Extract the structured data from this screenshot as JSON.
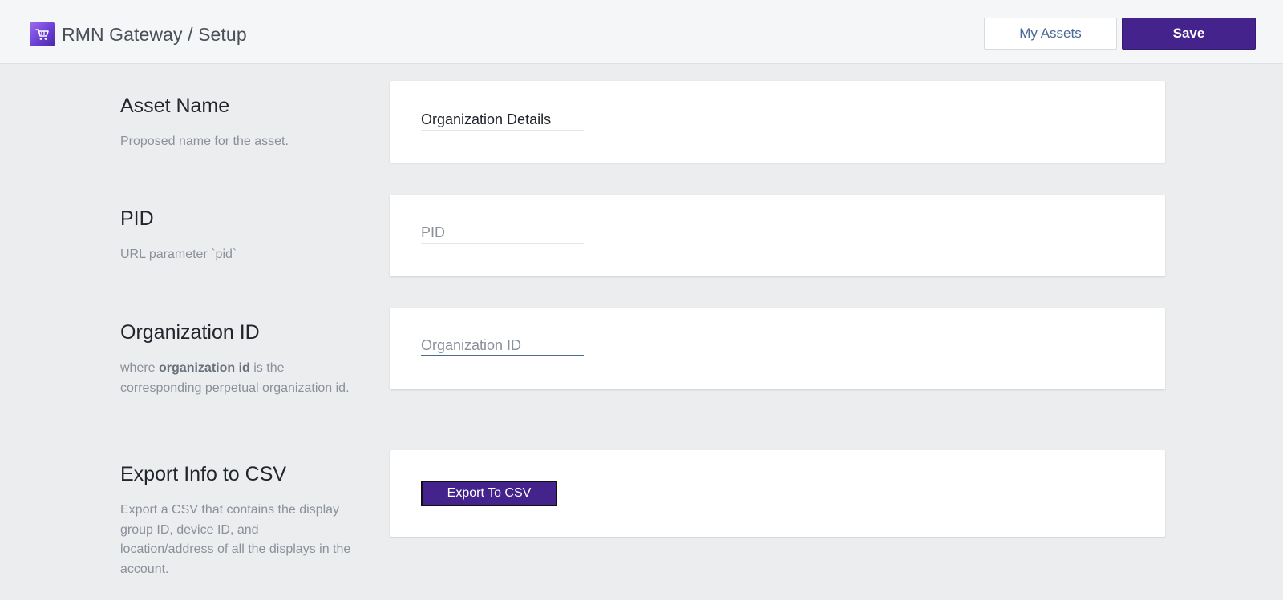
{
  "header": {
    "logo_icon": "shopping-cart-icon",
    "title": "RMN Gateway / Setup",
    "my_assets_label": "My Assets",
    "save_label": "Save"
  },
  "sections": {
    "asset_name": {
      "title": "Asset Name",
      "description": "Proposed name for the asset.",
      "value": "Organization Details",
      "placeholder": "Asset Name"
    },
    "pid": {
      "title": "PID",
      "description": "URL parameter `pid`",
      "value": "",
      "placeholder": "PID"
    },
    "organization_id": {
      "title": "Organization ID",
      "description_prefix": "where ",
      "description_bold": "organization id",
      "description_suffix": " is the corresponding perpetual organization id.",
      "value": "",
      "placeholder": "Organization ID"
    },
    "export": {
      "title": "Export Info to CSV",
      "description": "Export a CSV that contains the display group ID, device ID, and location/address of all the displays in the account.",
      "button_label": "Export To CSV"
    }
  },
  "colors": {
    "primary": "#44238c",
    "page_background": "#ecedef",
    "header_background": "#f5f6f8",
    "link_blue": "#4a6a97"
  }
}
